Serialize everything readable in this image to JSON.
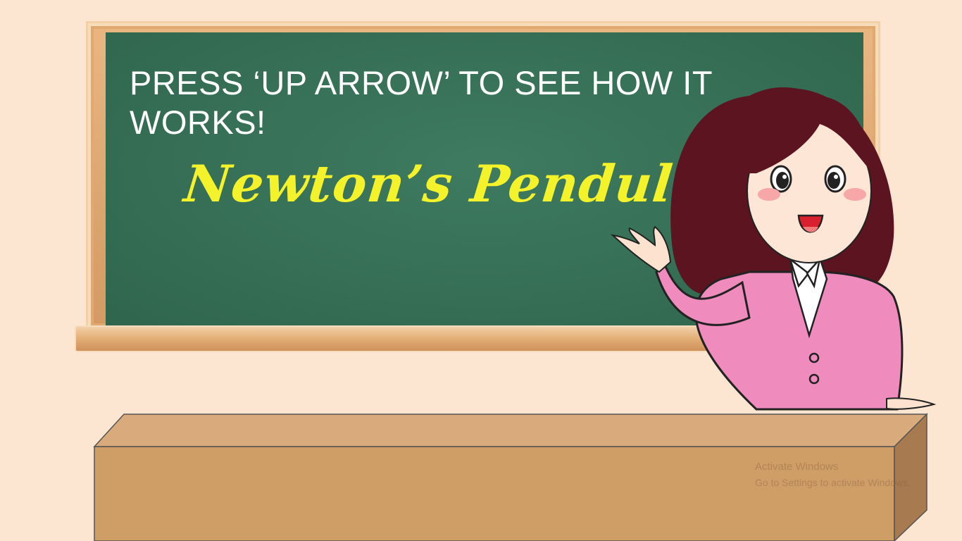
{
  "slide": {
    "instruction": "PRESS ‘UP ARROW’ TO SEE HOW IT WORKS!",
    "title": "Newton’s Pendulum"
  },
  "watermark": {
    "line1": "Activate Windows",
    "line2": "Go to Settings to activate Windows."
  },
  "colors": {
    "background": "#fde6d1",
    "chalkboard": "#356e55",
    "title_text": "#f4f22a",
    "desk": "#cf9d66"
  }
}
